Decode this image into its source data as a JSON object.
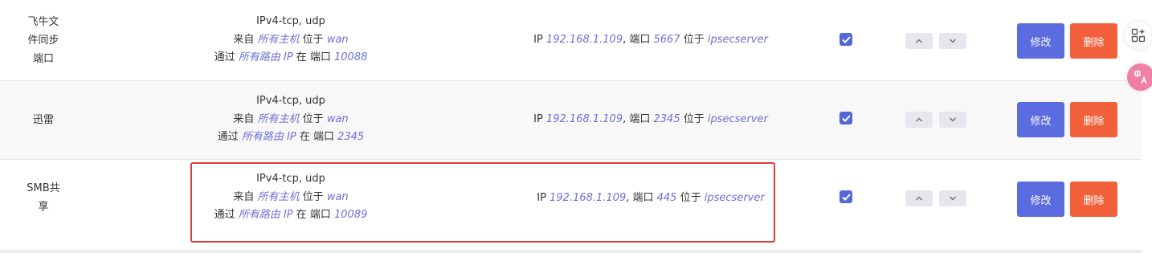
{
  "rules": [
    {
      "name": "飞牛文件同步端口",
      "name_lines": [
        "飞牛文",
        "件同步",
        "端口"
      ],
      "protocol": "IPv4-tcp, udp",
      "from_prefix": "来自",
      "from_host": "所有主机",
      "in_label": "位于",
      "from_zone": "wan",
      "via_prefix": "通过",
      "via_router": "所有路由 IP",
      "at_label": "在 端口",
      "external_port": "10088",
      "dest_ip_label": "IP",
      "dest_ip": "192.168.1.109",
      "dest_port_label": ", 端口",
      "dest_port": "5667",
      "dest_in_label": "位于",
      "dest_zone": "ipsecserver",
      "enabled": true
    },
    {
      "name": "迅雷",
      "name_lines": [
        "迅雷"
      ],
      "protocol": "IPv4-tcp, udp",
      "from_prefix": "来自",
      "from_host": "所有主机",
      "in_label": "位于",
      "from_zone": "wan",
      "via_prefix": "通过",
      "via_router": "所有路由 IP",
      "at_label": "在 端口",
      "external_port": "2345",
      "dest_ip_label": "IP",
      "dest_ip": "192.168.1.109",
      "dest_port_label": ", 端口",
      "dest_port": "2345",
      "dest_in_label": "位于",
      "dest_zone": "ipsecserver",
      "enabled": true
    },
    {
      "name": "SMB共享",
      "name_lines": [
        "SMB共",
        "享"
      ],
      "protocol": "IPv4-tcp, udp",
      "from_prefix": "来自",
      "from_host": "所有主机",
      "in_label": "位于",
      "from_zone": "wan",
      "via_prefix": "通过",
      "via_router": "所有路由 IP",
      "at_label": "在 端口",
      "external_port": "10089",
      "dest_ip_label": "IP",
      "dest_ip": "192.168.1.109",
      "dest_port_label": ", 端口",
      "dest_port": "445",
      "dest_in_label": "位于",
      "dest_zone": "ipsecserver",
      "enabled": true
    }
  ],
  "buttons": {
    "edit": "修改",
    "delete": "删除"
  },
  "icons": {
    "move_up": "chevron-up-icon",
    "move_down": "chevron-down-icon",
    "apps": "apps-grid-icon",
    "translate": "translate-icon"
  },
  "colors": {
    "value_text": "#6a6fd8",
    "edit_button": "#5b6ce0",
    "delete_button": "#f2603c",
    "checkbox": "#5568d8",
    "highlight_border": "#e03a3a"
  }
}
